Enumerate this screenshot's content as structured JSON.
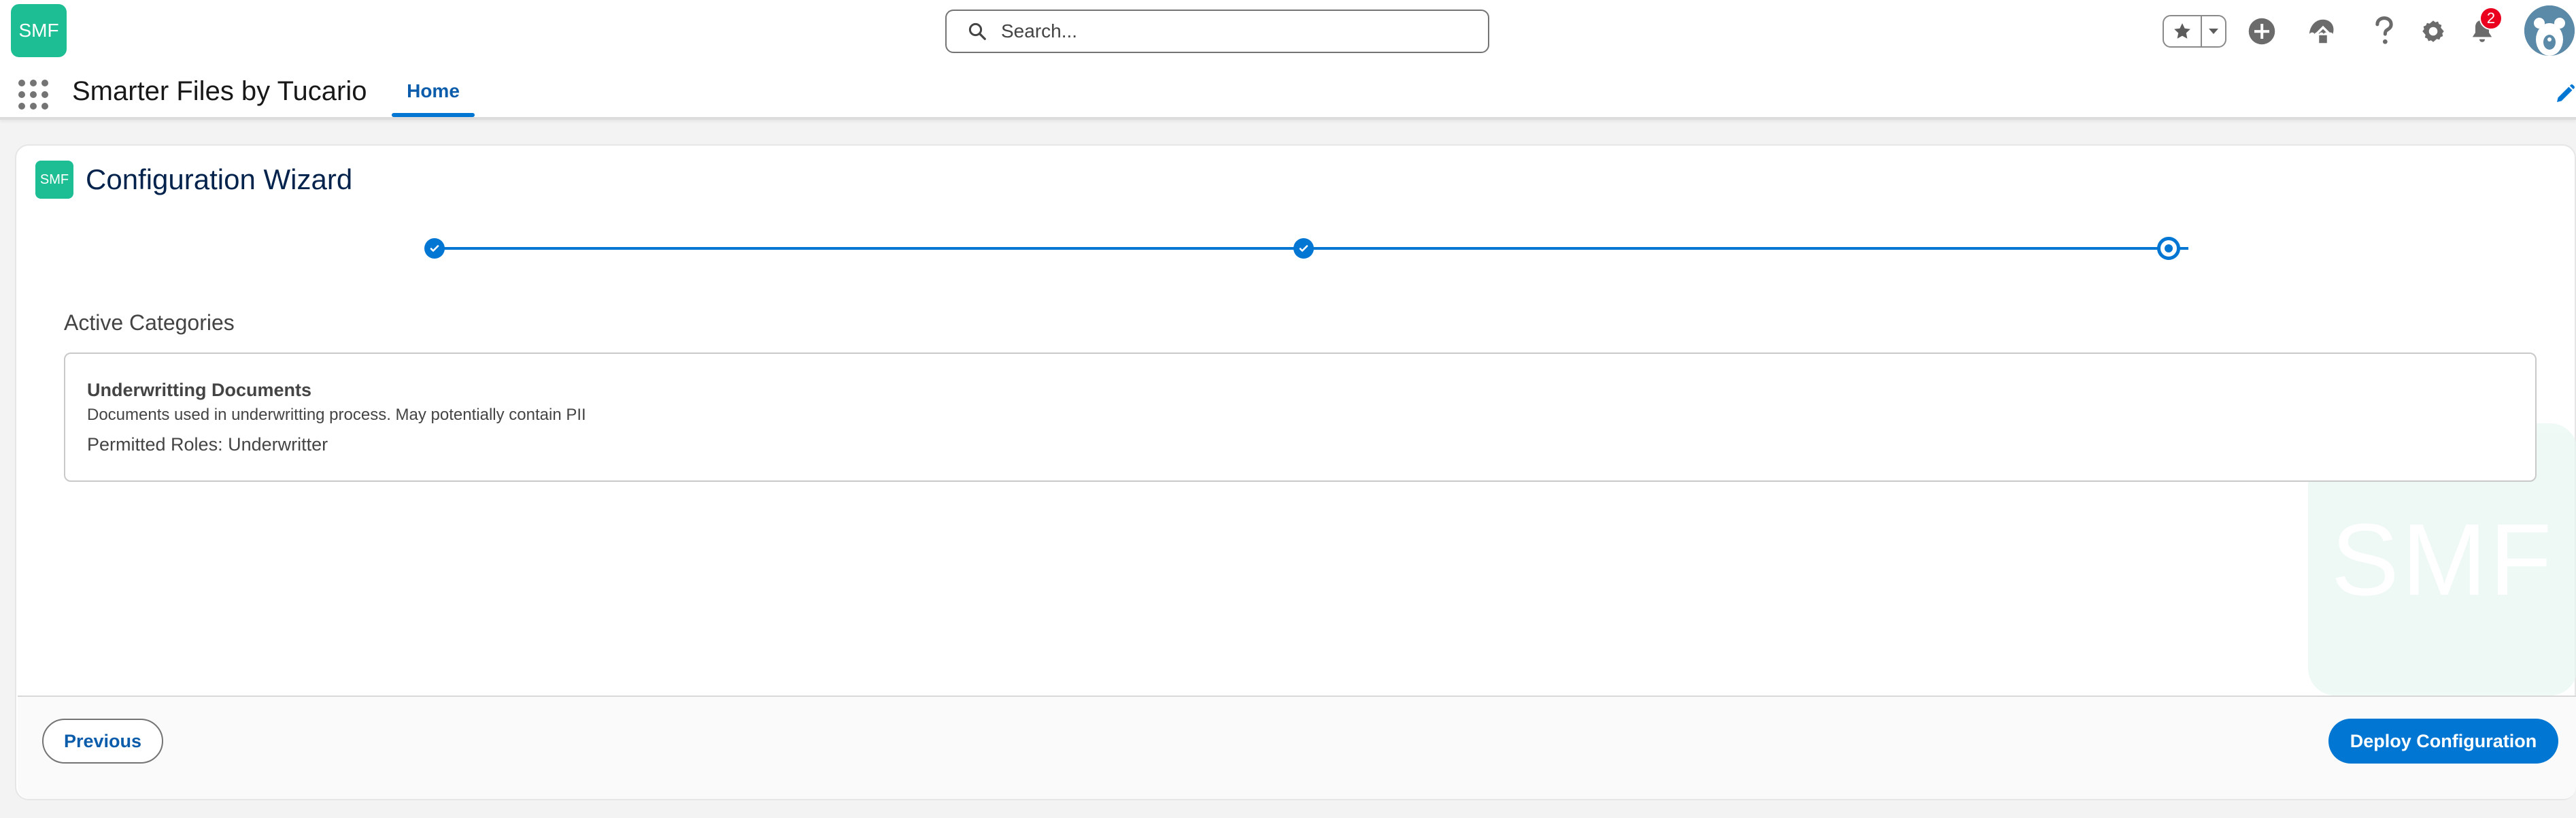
{
  "header": {
    "logo_text": "SMF",
    "search": {
      "placeholder": "Search..."
    },
    "notifications": {
      "count": "2"
    },
    "icons": [
      "star-icon",
      "chevron-down-icon",
      "add-icon",
      "trailhead-icon",
      "help-icon",
      "gear-icon",
      "bell-icon",
      "avatar"
    ]
  },
  "app_nav": {
    "app_name": "Smarter Files by Tucario",
    "tabs": [
      {
        "label": "Home",
        "active": true
      }
    ]
  },
  "wizard": {
    "logo_text": "SMF",
    "title": "Configuration Wizard",
    "progress": {
      "steps_total": 3,
      "steps_completed": 2,
      "current_step": 3
    },
    "section_heading": "Active Categories",
    "categories": [
      {
        "name": "Underwritting Documents",
        "description": "Documents used in underwritting process. May potentially contain PII",
        "roles_label": "Permitted Roles:",
        "roles_value": "Underwritter"
      }
    ],
    "watermark_text": "SMF",
    "footer": {
      "previous_label": "Previous",
      "deploy_label": "Deploy Configuration"
    }
  },
  "colors": {
    "brand": "#1dbe93",
    "accent": "#0176d3",
    "link": "#0b5cab",
    "badge": "#ea001e"
  }
}
